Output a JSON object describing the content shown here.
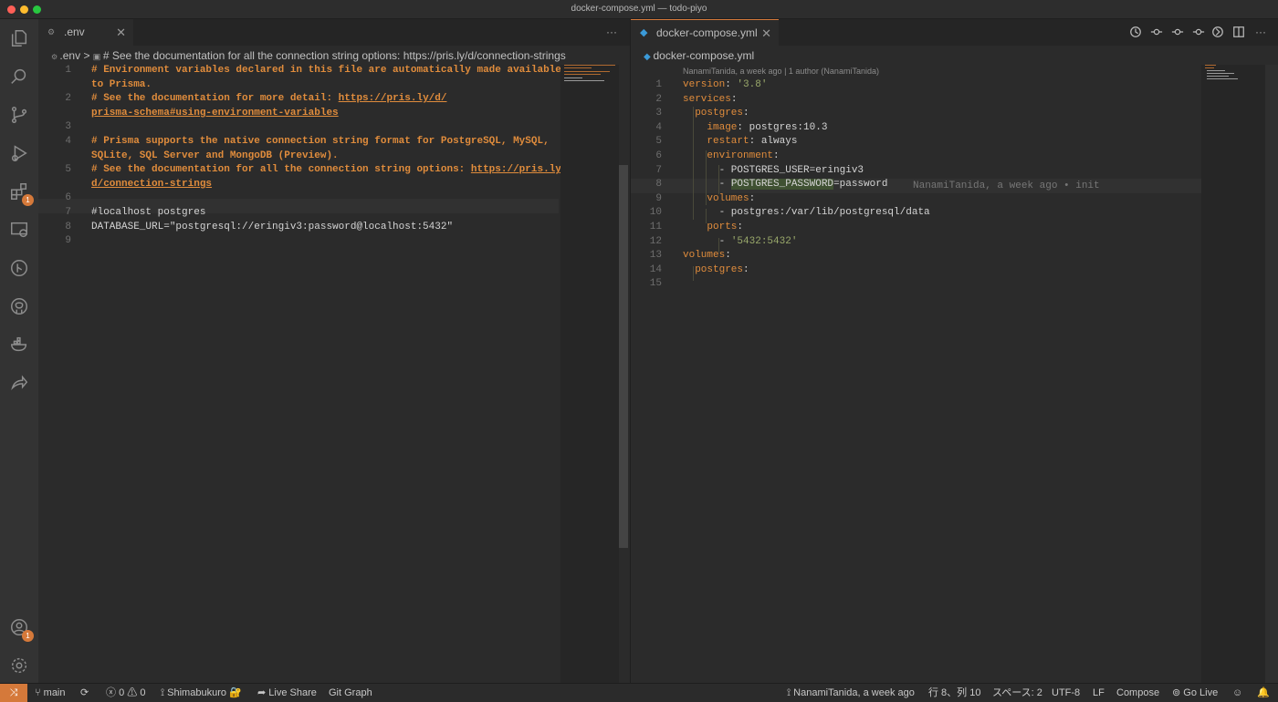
{
  "window": {
    "title": "docker-compose.yml — todo-piyo"
  },
  "activity_bar": {
    "extensions_badge": "1",
    "accounts_badge": "1"
  },
  "left_editor": {
    "tab_label": ".env",
    "more_actions": "···",
    "breadcrumb_file": ".env",
    "breadcrumb_separator": ">",
    "breadcrumb_symbol": "# See the documentation for all the connection string options: https://pris.ly/d/connection-strings",
    "lines": [
      {
        "n": "1",
        "segments": [
          {
            "t": "# Environment variables declared in this file are automatically made available",
            "c": "cm"
          }
        ]
      },
      {
        "n": "",
        "segments": [
          {
            "t": "to Prisma.",
            "c": "cm"
          }
        ]
      },
      {
        "n": "2",
        "segments": [
          {
            "t": "# See the documentation for more detail: ",
            "c": "cm"
          },
          {
            "t": "https://pris.ly/d/",
            "c": "lk"
          }
        ]
      },
      {
        "n": "",
        "segments": [
          {
            "t": "prisma-schema#using-environment-variables",
            "c": "lk"
          }
        ]
      },
      {
        "n": "3",
        "segments": []
      },
      {
        "n": "4",
        "segments": [
          {
            "t": "# Prisma supports the native connection string format for PostgreSQL, MySQL,",
            "c": "cm"
          }
        ]
      },
      {
        "n": "",
        "segments": [
          {
            "t": "SQLite, SQL Server and MongoDB (Preview).",
            "c": "cm"
          }
        ]
      },
      {
        "n": "5",
        "segments": [
          {
            "t": "# See the documentation for all the connection string options: ",
            "c": "cm"
          },
          {
            "t": "https://pris.ly/",
            "c": "lk"
          }
        ]
      },
      {
        "n": "",
        "segments": [
          {
            "t": "d/connection-strings",
            "c": "lk"
          }
        ]
      },
      {
        "n": "6",
        "segments": []
      },
      {
        "n": "7",
        "segments": [
          {
            "t": "#localhost postgres",
            "c": "plain"
          }
        ]
      },
      {
        "n": "8",
        "segments": [
          {
            "t": "DATABASE_URL=\"postgresql://eringiv3:password@localhost:5432\"",
            "c": "plain"
          }
        ]
      },
      {
        "n": "9",
        "segments": []
      }
    ]
  },
  "right_editor": {
    "tab_label": "docker-compose.yml",
    "breadcrumb_file": "docker-compose.yml",
    "codelens": "NanamiTanida, a week ago | 1 author (NanamiTanida)",
    "inline_blame": "NanamiTanida, a week ago • init",
    "lines": [
      {
        "n": "1",
        "segments": [
          {
            "t": "version",
            "c": "key"
          },
          {
            "t": ": ",
            "c": "plain"
          },
          {
            "t": "'3.8'",
            "c": "str"
          }
        ]
      },
      {
        "n": "2",
        "segments": [
          {
            "t": "services",
            "c": "key"
          },
          {
            "t": ":",
            "c": "plain"
          }
        ]
      },
      {
        "n": "3",
        "segments": [
          {
            "t": "  postgres",
            "c": "key"
          },
          {
            "t": ":",
            "c": "plain"
          }
        ]
      },
      {
        "n": "4",
        "segments": [
          {
            "t": "    image",
            "c": "key"
          },
          {
            "t": ": postgres:10.3",
            "c": "plain"
          }
        ]
      },
      {
        "n": "5",
        "segments": [
          {
            "t": "    restart",
            "c": "key"
          },
          {
            "t": ": always",
            "c": "plain"
          }
        ]
      },
      {
        "n": "6",
        "segments": [
          {
            "t": "    environment",
            "c": "key"
          },
          {
            "t": ":",
            "c": "plain"
          }
        ]
      },
      {
        "n": "7",
        "segments": [
          {
            "t": "      - POSTGRES_USER=eringiv3",
            "c": "plain"
          }
        ]
      },
      {
        "n": "8",
        "segments": [
          {
            "t": "      - ",
            "c": "plain"
          },
          {
            "t": "POSTGRES_PASSWORD",
            "c": "plain hl"
          },
          {
            "t": "=password",
            "c": "plain"
          }
        ]
      },
      {
        "n": "9",
        "segments": [
          {
            "t": "    volumes",
            "c": "key"
          },
          {
            "t": ":",
            "c": "plain"
          }
        ]
      },
      {
        "n": "10",
        "segments": [
          {
            "t": "      - postgres:/var/lib/postgresql/data",
            "c": "plain"
          }
        ]
      },
      {
        "n": "11",
        "segments": [
          {
            "t": "    ports",
            "c": "key"
          },
          {
            "t": ":",
            "c": "plain"
          }
        ]
      },
      {
        "n": "12",
        "segments": [
          {
            "t": "      - ",
            "c": "plain"
          },
          {
            "t": "'5432:5432'",
            "c": "str"
          }
        ]
      },
      {
        "n": "13",
        "segments": [
          {
            "t": "volumes",
            "c": "key"
          },
          {
            "t": ":",
            "c": "plain"
          }
        ]
      },
      {
        "n": "14",
        "segments": [
          {
            "t": "  postgres",
            "c": "key"
          },
          {
            "t": ":",
            "c": "plain"
          }
        ]
      },
      {
        "n": "15",
        "segments": []
      }
    ]
  },
  "status_bar": {
    "branch": "main",
    "errors": "0",
    "warnings": "0",
    "user": "Shimabukuro",
    "live_share": "Live Share",
    "git_graph": "Git Graph",
    "blame": "NanamiTanida, a week ago",
    "position": "行 8、列 10",
    "spaces": "スペース: 2",
    "encoding": "UTF-8",
    "eol": "LF",
    "language": "Compose",
    "go_live": "Go Live"
  },
  "colors": {
    "accent": "#d5793a",
    "comment": "#e08c3c",
    "string": "#9aa96b",
    "background": "#2b2b2b"
  }
}
